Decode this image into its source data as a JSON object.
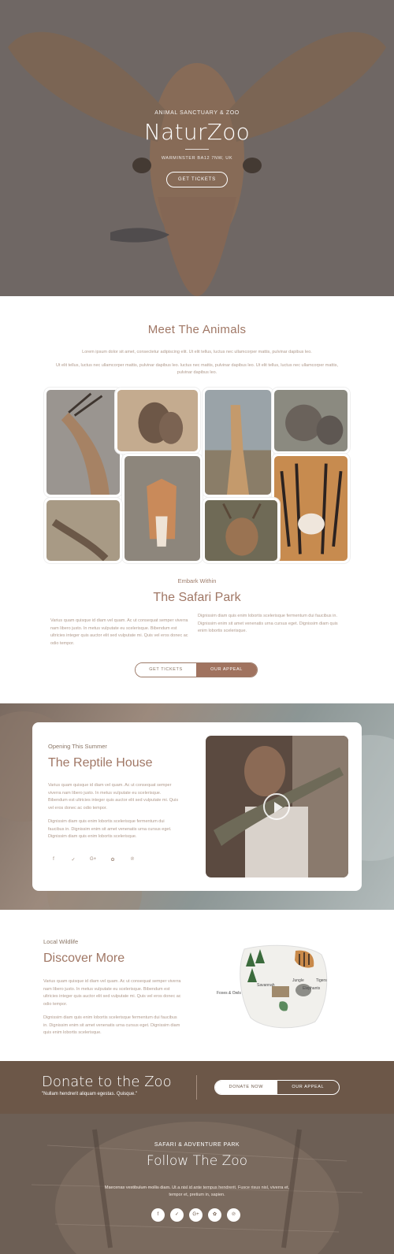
{
  "hero": {
    "eyebrow": "ANIMAL SANCTUARY & ZOO",
    "title": "NaturZoo",
    "address": "WARMINSTER BA12 7NW, UK",
    "cta": "GET TICKETS"
  },
  "meet": {
    "title": "Meet The Animals",
    "p1": "Lorem ipsum dolor sit amet, consectetur adipiscing elit. Ut elit tellus, luctus nec ullamcorper mattis, pulvinar dapibus leo.",
    "p2": "Ut elit tellus, luctus nec ullamcorper mattis, pulvinar dapibus leo. luctus nec mattis, pulvinar dapibus leo. Ut elit tellus, luctus nec ullamcorper mattis, pulvinar dapibus leo."
  },
  "safari": {
    "eyebrow": "Embark Within",
    "title": "The Safari Park",
    "left": "Varius quam quisque id diam vel quam. Ac ut consequat semper viverra nam libero justo. In metus vulputate eu scelerisque. Bibendum est ultricies integer quis auctor elit sed vulputate mi. Quis vel eros donec ac odio tempor.",
    "right": "Dignissim diam quis enim lobortis scelerisque fermentum dui faucibus in. Dignissim enim sit amet venenatis urna cursus eget. Dignissim diam quis enim lobortis scelerisque.",
    "btn_tickets": "GET TICKETS",
    "btn_appeal": "OUR APPEAL"
  },
  "reptile": {
    "eyebrow": "Opening This Summer",
    "title": "The Reptile House",
    "p1": "Varius quam quisque id diam vel quam. Ac ut consequat semper viverra nam libero justo. In metus vulputate eu scelerisque. Bibendum est ultricies integer quis auctor elit sed vulputate mi. Quis vel eros donec ac odio tempor.",
    "p2": "Dignissim diam quis enim lobortis scelerisque fermentum dui faucibus in. Dignissim enim sit amet venenatis urna cursus eget. Dignissim diam quis enim lobortis scelerisque.",
    "social": [
      "f",
      "✓",
      "G+",
      "✿",
      "℗"
    ]
  },
  "discover": {
    "eyebrow": "Local Wildlife",
    "title": "Discover More",
    "p1": "Varius quam quisque id diam vel quam. Ac ut consequat semper viverra nam libero justo. In metus vulputate eu scelerisque. Bibendum est ultricies integer quis auctor elit sed vulputate mi. Quis vel eros donec ac odio tempor.",
    "p2": "Dignissim diam quis enim lobortis scelerisque fermentum dui faucibus in. Dignissim enim sit amet venenatis urna cursus eget. Dignissim diam quis enim lobortis scelerisque.",
    "map_labels": {
      "foxes": "Foxes & Owls",
      "savannah": "Savannah",
      "jungle": "Jungle",
      "tigers": "Tigers",
      "elephants": "Elephants"
    }
  },
  "donate": {
    "title": "Donate to the Zoo",
    "quote": "\"Nullam hendrerit aliquam egestas. Quisque.\"",
    "btn_donate": "DONATE NOW",
    "btn_appeal": "OUR APPEAL"
  },
  "follow": {
    "eyebrow": "SAFARI & ADVENTURE PARK",
    "title": "Follow The Zoo",
    "text": "Maecenas vestibulum mollis diam. Ut a nisl id ante tempus hendrerit. Fusce risus nisl, viverra et, tempor et, pretium in, sapien.",
    "social": [
      "f",
      "✓",
      "G+",
      "✿",
      "℗"
    ]
  },
  "colors": {
    "accent": "#a07765",
    "brown": "#6c5748",
    "body_text": "#b09a8c"
  }
}
